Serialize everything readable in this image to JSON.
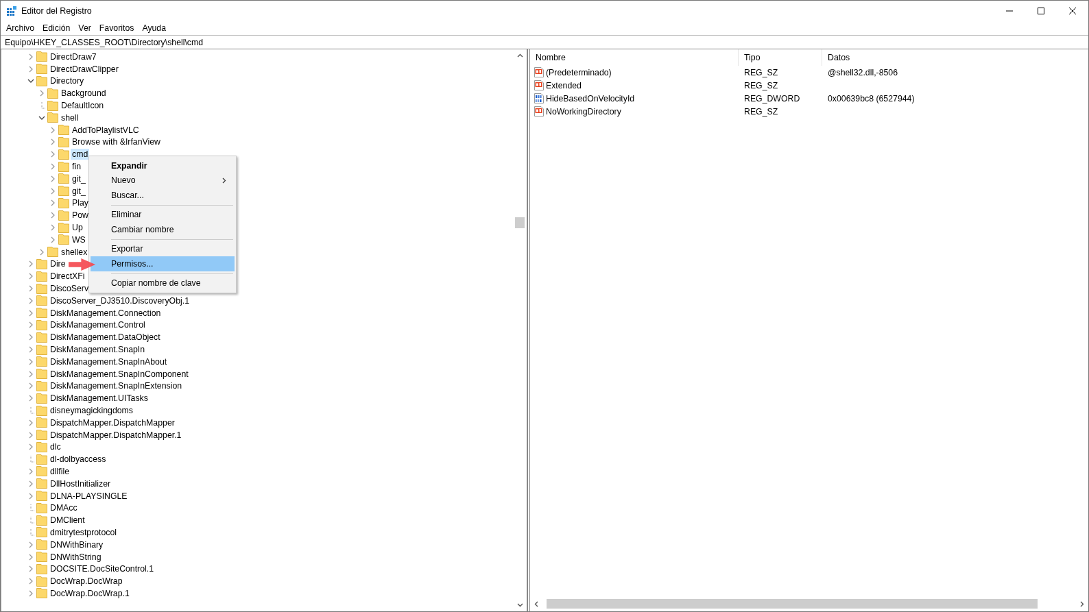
{
  "window": {
    "title": "Editor del Registro"
  },
  "menu_bar": [
    "Archivo",
    "Edición",
    "Ver",
    "Favoritos",
    "Ayuda"
  ],
  "address": "Equipo\\HKEY_CLASSES_ROOT\\Directory\\shell\\cmd",
  "tree": [
    {
      "label": "DirectDraw7",
      "kind": "branch",
      "expanded": false,
      "selected": false
    },
    {
      "label": "DirectDrawClipper",
      "kind": "branch",
      "expanded": false,
      "selected": false
    },
    {
      "label": "Directory",
      "kind": "branch",
      "expanded": true,
      "selected": false,
      "children": [
        {
          "label": "Background",
          "kind": "branch",
          "expanded": false,
          "selected": false
        },
        {
          "label": "DefaultIcon",
          "kind": "leaf",
          "expanded": false,
          "selected": false
        },
        {
          "label": "shell",
          "kind": "branch",
          "expanded": true,
          "selected": false,
          "children": [
            {
              "label": "AddToPlaylistVLC",
              "kind": "branch",
              "expanded": false,
              "selected": false
            },
            {
              "label": "Browse with &IrfanView",
              "kind": "branch",
              "expanded": false,
              "selected": false
            },
            {
              "label": "cmd",
              "kind": "branch",
              "expanded": false,
              "selected": true
            },
            {
              "label": "fin",
              "kind": "branch",
              "expanded": false,
              "selected": false
            },
            {
              "label": "git_",
              "kind": "branch",
              "expanded": false,
              "selected": false
            },
            {
              "label": "git_",
              "kind": "branch",
              "expanded": false,
              "selected": false
            },
            {
              "label": "Play",
              "kind": "branch",
              "expanded": false,
              "selected": false
            },
            {
              "label": "Pow",
              "kind": "branch",
              "expanded": false,
              "selected": false
            },
            {
              "label": "Up",
              "kind": "branch",
              "expanded": false,
              "selected": false
            },
            {
              "label": "WS",
              "kind": "branch",
              "expanded": false,
              "selected": false
            }
          ]
        },
        {
          "label": "shellex",
          "kind": "branch",
          "expanded": false,
          "selected": false
        }
      ]
    },
    {
      "label": "Dire",
      "kind": "branch",
      "expanded": false,
      "selected": false
    },
    {
      "label": "DirectXFi",
      "kind": "branch",
      "expanded": false,
      "selected": false
    },
    {
      "label": "DiscoServ",
      "kind": "branch",
      "expanded": false,
      "selected": false
    },
    {
      "label": "DiscoServer_DJ3510.DiscoveryObj.1",
      "kind": "branch",
      "expanded": false,
      "selected": false
    },
    {
      "label": "DiskManagement.Connection",
      "kind": "branch",
      "expanded": false,
      "selected": false
    },
    {
      "label": "DiskManagement.Control",
      "kind": "branch",
      "expanded": false,
      "selected": false
    },
    {
      "label": "DiskManagement.DataObject",
      "kind": "branch",
      "expanded": false,
      "selected": false
    },
    {
      "label": "DiskManagement.SnapIn",
      "kind": "branch",
      "expanded": false,
      "selected": false
    },
    {
      "label": "DiskManagement.SnapInAbout",
      "kind": "branch",
      "expanded": false,
      "selected": false
    },
    {
      "label": "DiskManagement.SnapInComponent",
      "kind": "branch",
      "expanded": false,
      "selected": false
    },
    {
      "label": "DiskManagement.SnapInExtension",
      "kind": "branch",
      "expanded": false,
      "selected": false
    },
    {
      "label": "DiskManagement.UITasks",
      "kind": "branch",
      "expanded": false,
      "selected": false
    },
    {
      "label": "disneymagickingdoms",
      "kind": "leaf",
      "expanded": false,
      "selected": false
    },
    {
      "label": "DispatchMapper.DispatchMapper",
      "kind": "branch",
      "expanded": false,
      "selected": false
    },
    {
      "label": "DispatchMapper.DispatchMapper.1",
      "kind": "branch",
      "expanded": false,
      "selected": false
    },
    {
      "label": "dlc",
      "kind": "branch",
      "expanded": false,
      "selected": false
    },
    {
      "label": "dl-dolbyaccess",
      "kind": "leaf",
      "expanded": false,
      "selected": false
    },
    {
      "label": "dllfile",
      "kind": "branch",
      "expanded": false,
      "selected": false
    },
    {
      "label": "DllHostInitializer",
      "kind": "branch",
      "expanded": false,
      "selected": false
    },
    {
      "label": "DLNA-PLAYSINGLE",
      "kind": "branch",
      "expanded": false,
      "selected": false
    },
    {
      "label": "DMAcc",
      "kind": "leaf",
      "expanded": false,
      "selected": false
    },
    {
      "label": "DMClient",
      "kind": "leaf",
      "expanded": false,
      "selected": false
    },
    {
      "label": "dmitrytestprotocol",
      "kind": "leaf",
      "expanded": false,
      "selected": false
    },
    {
      "label": "DNWithBinary",
      "kind": "branch",
      "expanded": false,
      "selected": false
    },
    {
      "label": "DNWithString",
      "kind": "branch",
      "expanded": false,
      "selected": false
    },
    {
      "label": "DOCSITE.DocSiteControl.1",
      "kind": "branch",
      "expanded": false,
      "selected": false
    },
    {
      "label": "DocWrap.DocWrap",
      "kind": "branch",
      "expanded": false,
      "selected": false
    },
    {
      "label": "DocWrap.DocWrap.1",
      "kind": "branch",
      "expanded": false,
      "selected": false
    }
  ],
  "values": {
    "columns": [
      "Nombre",
      "Tipo",
      "Datos"
    ],
    "rows": [
      {
        "kind": "string",
        "name": "(Predeterminado)",
        "type": "REG_SZ",
        "data": "@shell32.dll,-8506"
      },
      {
        "kind": "string",
        "name": "Extended",
        "type": "REG_SZ"
      },
      {
        "kind": "dword",
        "name": "HideBasedOnVelocityId",
        "type": "REG_DWORD",
        "data": "0x00639bc8 (6527944)"
      },
      {
        "kind": "string",
        "name": "NoWorkingDirectory",
        "type": "REG_SZ"
      }
    ]
  },
  "context_menu": {
    "groups": [
      [
        {
          "label": "Expandir",
          "default": true,
          "submenu": false,
          "selected": false
        },
        {
          "label": "Nuevo",
          "default": false,
          "submenu": true,
          "selected": false
        },
        {
          "label": "Buscar...",
          "default": false,
          "submenu": false,
          "selected": false
        }
      ],
      [
        {
          "label": "Eliminar",
          "default": false,
          "submenu": false,
          "selected": false
        },
        {
          "label": "Cambiar nombre",
          "default": false,
          "submenu": false,
          "selected": false
        }
      ],
      [
        {
          "label": "Exportar",
          "default": false,
          "submenu": false,
          "selected": false
        },
        {
          "label": "Permisos...",
          "default": false,
          "submenu": false,
          "selected": true
        }
      ],
      [
        {
          "label": "Copiar nombre de clave",
          "default": false,
          "submenu": false,
          "selected": false
        }
      ]
    ]
  }
}
